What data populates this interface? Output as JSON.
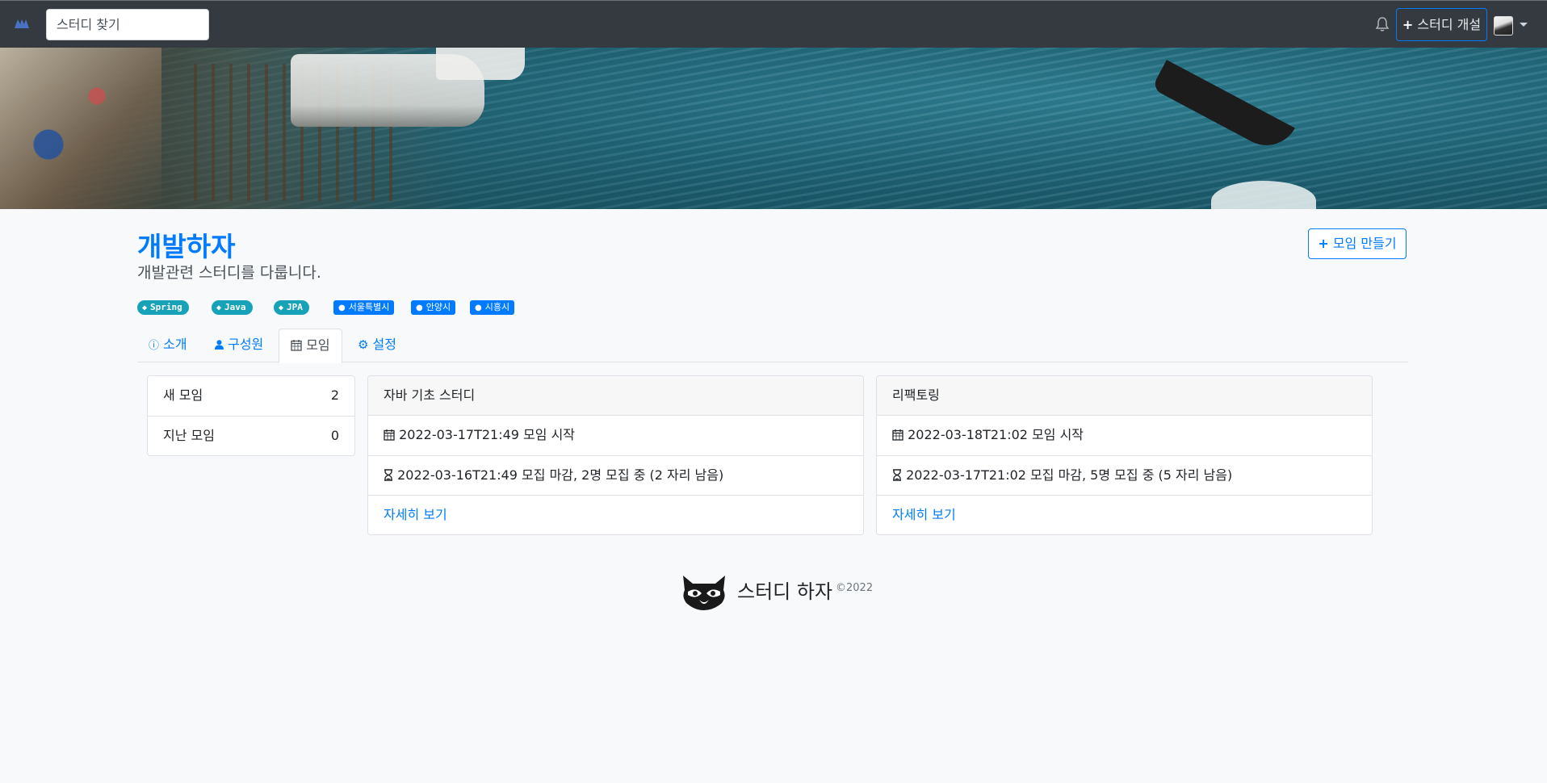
{
  "navbar": {
    "search_placeholder": "스터디 찾기",
    "open_study_label": "스터디 개설",
    "icons": {
      "brand": "brand-logo-icon",
      "bell": "bell-icon",
      "plus": "plus-icon",
      "caret": "caret-down-icon"
    }
  },
  "study": {
    "title": "개발하자",
    "short_description": "개발관련 스터디를 다룹니다.",
    "new_event_label": "모임 만들기",
    "tags": [
      "Spring",
      "Java",
      "JPA"
    ],
    "zones": [
      "서울특별시",
      "안양시",
      "시흥시"
    ]
  },
  "tabs": [
    {
      "label": "소개",
      "icon": "info-circle-icon"
    },
    {
      "label": "구성원",
      "icon": "user-icon"
    },
    {
      "label": "모임",
      "icon": "calendar-icon",
      "active": true
    },
    {
      "label": "설정",
      "icon": "gear-icon"
    }
  ],
  "event_summary": [
    {
      "label": "새 모임",
      "count": "2"
    },
    {
      "label": "지난 모임",
      "count": "0"
    }
  ],
  "events": [
    {
      "title": "자바 기초 스터디",
      "start": "2022-03-17T21:49 모임 시작",
      "deadline": "2022-03-16T21:49 모집 마감, 2명 모집 중 (2 자리 남음)",
      "detail_link": "자세히 보기"
    },
    {
      "title": "리팩토링",
      "start": "2022-03-18T21:02 모임 시작",
      "deadline": "2022-03-17T21:02 모집 마감, 5명 모집 중 (5 자리 남음)",
      "detail_link": "자세히 보기"
    }
  ],
  "footer": {
    "name": "스터디 하자",
    "copyright": "©2022"
  },
  "colors": {
    "primary": "#007bff",
    "navbar": "#343a40",
    "tag": "#17a2b8",
    "background": "#f8f9fa"
  }
}
